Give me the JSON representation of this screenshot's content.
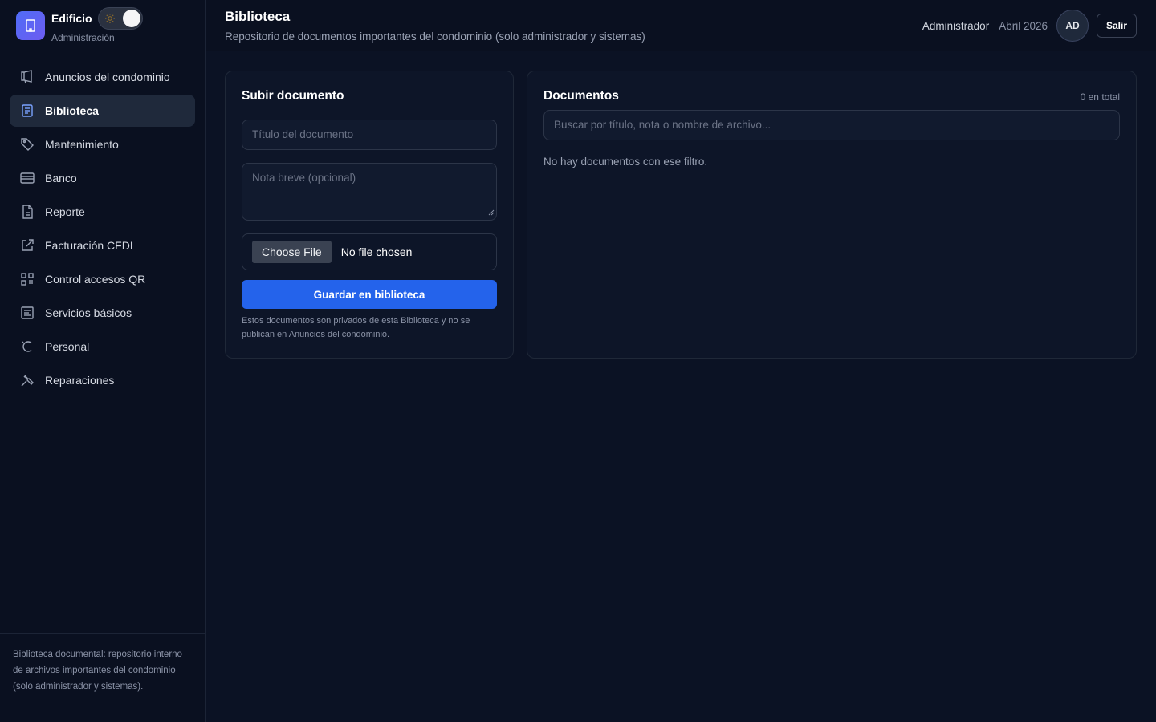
{
  "brand": {
    "name": "Edificio",
    "subtitle": "Administración",
    "logo_icon": "building-icon",
    "theme_toggle_icon": "sun-icon"
  },
  "sidebar": {
    "items": [
      {
        "label": "Anuncios del condominio",
        "icon": "megaphone-icon",
        "active": false
      },
      {
        "label": "Biblioteca",
        "icon": "book-icon",
        "active": true
      },
      {
        "label": "Mantenimiento",
        "icon": "tag-icon",
        "active": false
      },
      {
        "label": "Banco",
        "icon": "credit-card-icon",
        "active": false
      },
      {
        "label": "Reporte",
        "icon": "document-icon",
        "active": false
      },
      {
        "label": "Facturación CFDI",
        "icon": "external-edit-icon",
        "active": false
      },
      {
        "label": "Control accesos QR",
        "icon": "qr-grid-icon",
        "active": false
      },
      {
        "label": "Servicios básicos",
        "icon": "list-box-icon",
        "active": false
      },
      {
        "label": "Personal",
        "icon": "loader-icon",
        "active": false
      },
      {
        "label": "Reparaciones",
        "icon": "tools-icon",
        "active": false
      }
    ],
    "footer": "Biblioteca documental: repositorio interno de archivos importantes del condominio (solo administrador y sistemas)."
  },
  "header": {
    "title": "Biblioteca",
    "subtitle": "Repositorio de documentos importantes del condominio (solo administrador y sistemas)",
    "user_role": "Administrador",
    "period": "Abril 2026",
    "avatar_initials": "AD",
    "logout_label": "Salir"
  },
  "upload": {
    "title": "Subir documento",
    "title_placeholder": "Título del documento",
    "note_placeholder": "Nota breve (opcional)",
    "choose_file_label": "Choose File",
    "no_file_label": "No file chosen",
    "save_label": "Guardar en biblioteca",
    "help_text": "Estos documentos son privados de esta Biblioteca y no se publican en Anuncios del condominio."
  },
  "documents": {
    "title": "Documentos",
    "count_label": "0 en total",
    "search_placeholder": "Buscar por título, nota o nombre de archivo...",
    "empty_message": "No hay documentos con ese filtro."
  },
  "colors": {
    "accent": "#2463eb",
    "background": "#0b1224",
    "active_nav": "#1f293b"
  }
}
